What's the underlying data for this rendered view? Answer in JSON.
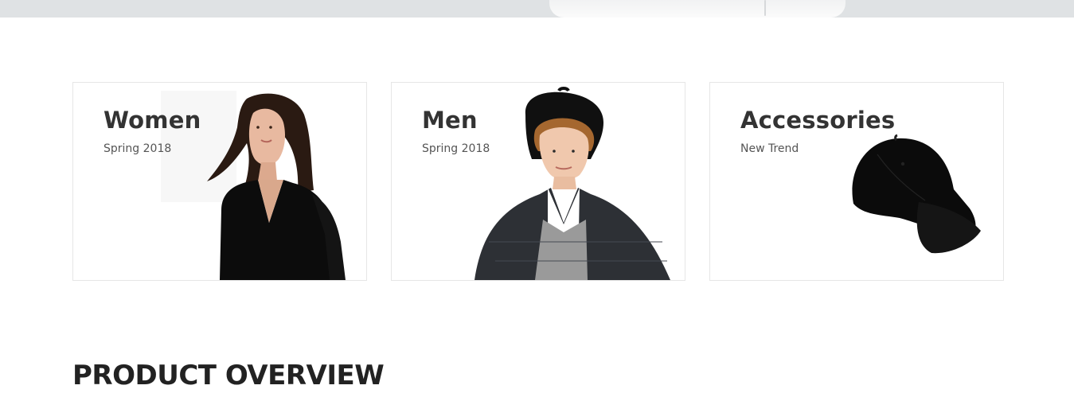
{
  "banners": [
    {
      "title": "Women",
      "subtitle": "Spring 2018",
      "icon": "woman-model-image"
    },
    {
      "title": "Men",
      "subtitle": "Spring 2018",
      "icon": "man-model-image"
    },
    {
      "title": "Accessories",
      "subtitle": "New Trend",
      "icon": "cap-image"
    }
  ],
  "section": {
    "title": "PRODUCT OVERVIEW"
  },
  "colors": {
    "text": "#333333",
    "border": "#e6e6e6",
    "hero_strip": "#dfe2e4"
  }
}
